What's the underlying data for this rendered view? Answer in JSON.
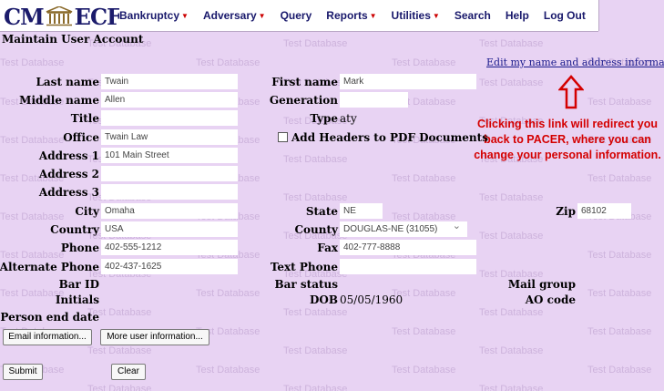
{
  "header": {
    "logo_left": "CM",
    "logo_right": "ECF",
    "menu": [
      {
        "label": "Bankruptcy",
        "dropdown": true
      },
      {
        "label": "Adversary",
        "dropdown": true
      },
      {
        "label": "Query",
        "dropdown": false
      },
      {
        "label": "Reports",
        "dropdown": true
      },
      {
        "label": "Utilities",
        "dropdown": true
      },
      {
        "label": "Search",
        "dropdown": false
      },
      {
        "label": "Help",
        "dropdown": false
      },
      {
        "label": "Log Out",
        "dropdown": false
      }
    ],
    "watermark": "Test Database"
  },
  "page": {
    "title": "Maintain User Account",
    "edit_link": "Edit my name and address information",
    "callout": "Clicking this link will redirect you back to PACER, where you can change your personal information."
  },
  "form": {
    "last_name": {
      "label": "Last name",
      "value": "Twain"
    },
    "first_name": {
      "label": "First name",
      "value": "Mark"
    },
    "middle_name": {
      "label": "Middle name",
      "value": "Allen"
    },
    "generation": {
      "label": "Generation",
      "value": ""
    },
    "title": {
      "label": "Title",
      "value": ""
    },
    "type": {
      "label": "Type",
      "value": "aty"
    },
    "office": {
      "label": "Office",
      "value": "Twain Law"
    },
    "add_headers": {
      "label": "Add Headers to PDF Documents",
      "checked": false
    },
    "address1": {
      "label": "Address 1",
      "value": "101 Main Street"
    },
    "address2": {
      "label": "Address 2",
      "value": ""
    },
    "address3": {
      "label": "Address 3",
      "value": ""
    },
    "city": {
      "label": "City",
      "value": "Omaha"
    },
    "state": {
      "label": "State",
      "value": "NE"
    },
    "zip": {
      "label": "Zip",
      "value": "68102"
    },
    "country": {
      "label": "Country",
      "value": "USA"
    },
    "county": {
      "label": "County",
      "value": "DOUGLAS-NE (31055)"
    },
    "phone": {
      "label": "Phone",
      "value": "402-555-1212"
    },
    "fax": {
      "label": "Fax",
      "value": "402-777-8888"
    },
    "alt_phone": {
      "label": "Alternate Phone",
      "value": "402-437-1625"
    },
    "text_phone": {
      "label": "Text Phone",
      "value": ""
    },
    "bar_id": {
      "label": "Bar ID",
      "value": ""
    },
    "bar_status": {
      "label": "Bar status",
      "value": ""
    },
    "mail_group": {
      "label": "Mail group",
      "value": ""
    },
    "initials": {
      "label": "Initials",
      "value": ""
    },
    "dob": {
      "label": "DOB",
      "value": "05/05/1960"
    },
    "ao_code": {
      "label": "AO code",
      "value": ""
    },
    "person_end_date": {
      "label": "Person end date",
      "value": ""
    }
  },
  "buttons": {
    "email_info": "Email information...",
    "more_user_info": "More user information...",
    "submit": "Submit",
    "clear": "Clear"
  },
  "colors": {
    "background": "#e8d3f3",
    "menu_text": "#18186b",
    "callout": "#d40000",
    "link": "#1a1a8c"
  }
}
